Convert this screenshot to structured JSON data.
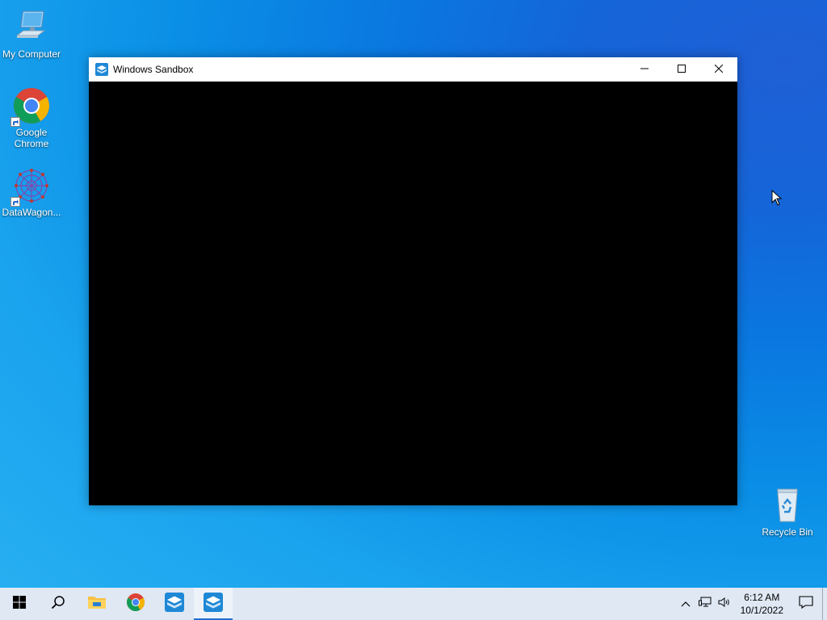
{
  "desktop": {
    "icons": [
      {
        "label": "My Computer",
        "icon": "computer-icon"
      },
      {
        "label": "Google Chrome",
        "icon": "chrome-icon"
      },
      {
        "label": "DataWagon...",
        "icon": "datawagon-icon"
      },
      {
        "label": "Recycle Bin",
        "icon": "recycle-bin-icon"
      }
    ]
  },
  "window": {
    "title": "Windows Sandbox",
    "icon": "sandbox-icon",
    "buttons": {
      "minimize": "minimize-icon",
      "maximize": "maximize-icon",
      "close": "close-icon"
    }
  },
  "taskbar": {
    "items": [
      "start-icon",
      "search-icon",
      "file-explorer-icon",
      "chrome-icon",
      "sandbox-icon",
      "sandbox-icon"
    ],
    "active_index": 5
  },
  "tray": {
    "time": "6:12 AM",
    "date": "10/1/2022",
    "icons": [
      "chevron-up-icon",
      "network-icon",
      "volume-icon",
      "notifications-icon"
    ]
  },
  "colors": {
    "desktop": "#0a8fe6",
    "taskbar": "#dfe8f3",
    "accent": "#1f6fd1",
    "sandbox_content": "#000000"
  }
}
